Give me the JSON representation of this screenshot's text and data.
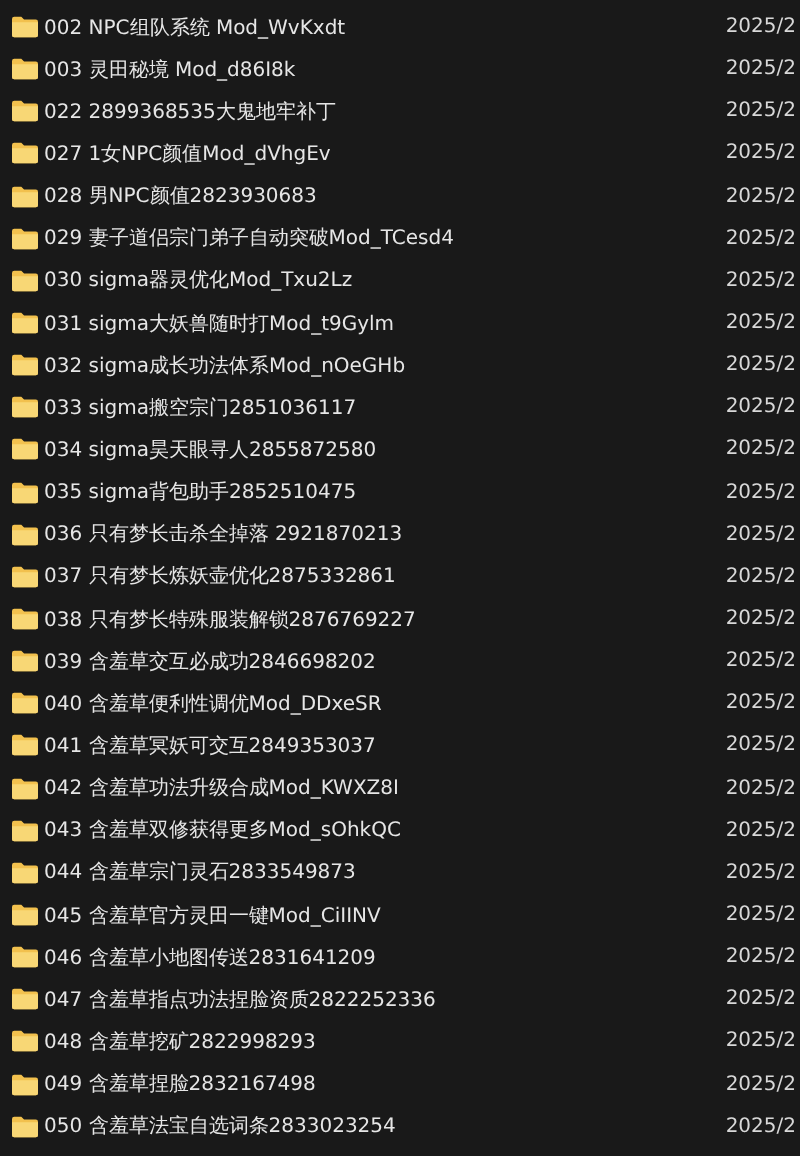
{
  "rows": [
    {
      "name": "002 NPC组队系统 Mod_WvKxdt",
      "date": "2025/2"
    },
    {
      "name": "003 灵田秘境 Mod_d86I8k",
      "date": "2025/2"
    },
    {
      "name": "022 2899368535大鬼地牢补丁",
      "date": "2025/2"
    },
    {
      "name": "027 1女NPC颜值Mod_dVhgEv",
      "date": "2025/2"
    },
    {
      "name": "028 男NPC颜值2823930683",
      "date": "2025/2"
    },
    {
      "name": "029 妻子道侣宗门弟子自动突破Mod_TCesd4",
      "date": "2025/2"
    },
    {
      "name": "030 sigma器灵优化Mod_Txu2Lz",
      "date": "2025/2"
    },
    {
      "name": "031 sigma大妖兽随时打Mod_t9Gylm",
      "date": "2025/2"
    },
    {
      "name": "032 sigma成长功法体系Mod_nOeGHb",
      "date": "2025/2"
    },
    {
      "name": "033 sigma搬空宗门2851036117",
      "date": "2025/2"
    },
    {
      "name": "034 sigma昊天眼寻人2855872580",
      "date": "2025/2"
    },
    {
      "name": "035 sigma背包助手2852510475",
      "date": "2025/2"
    },
    {
      "name": "036 只有梦长击杀全掉落 2921870213",
      "date": "2025/2"
    },
    {
      "name": "037 只有梦长炼妖壶优化2875332861",
      "date": "2025/2"
    },
    {
      "name": "038 只有梦长特殊服装解锁2876769227",
      "date": "2025/2"
    },
    {
      "name": "039 含羞草交互必成功2846698202",
      "date": "2025/2"
    },
    {
      "name": "040 含羞草便利性调优Mod_DDxeSR",
      "date": "2025/2"
    },
    {
      "name": "041 含羞草冥妖可交互2849353037",
      "date": "2025/2"
    },
    {
      "name": "042 含羞草功法升级合成Mod_KWXZ8I",
      "date": "2025/2"
    },
    {
      "name": "043 含羞草双修获得更多Mod_sOhkQC",
      "date": "2025/2"
    },
    {
      "name": "044 含羞草宗门灵石2833549873",
      "date": "2025/2"
    },
    {
      "name": "045 含羞草官方灵田一键Mod_CiIINV",
      "date": "2025/2"
    },
    {
      "name": "046 含羞草小地图传送2831641209",
      "date": "2025/2"
    },
    {
      "name": "047 含羞草指点功法捏脸资质2822252336",
      "date": "2025/2"
    },
    {
      "name": "048 含羞草挖矿2822998293",
      "date": "2025/2"
    },
    {
      "name": "049 含羞草捏脸2832167498",
      "date": "2025/2"
    },
    {
      "name": "050 含羞草法宝自选词条2833023254",
      "date": "2025/2"
    }
  ]
}
